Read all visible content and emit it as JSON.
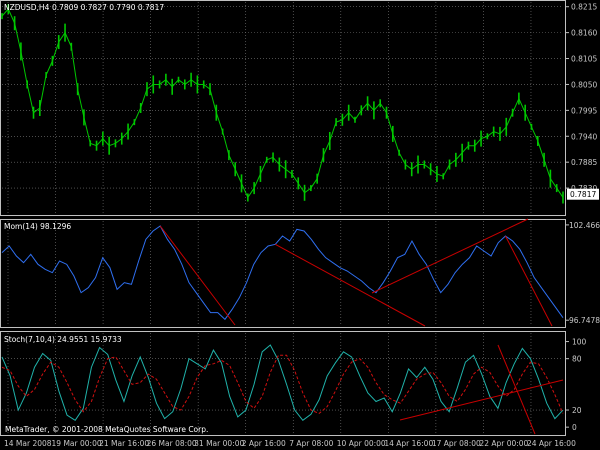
{
  "colors": {
    "background": "#000000",
    "frame": "#c0c0c0",
    "grid": "#7a7a7a",
    "price_line": "#00c800",
    "momentum": "#2f6ff0",
    "stoch_main": "#20b2aa",
    "stoch_signal": "#d01010",
    "trendline": "#c80000",
    "axis_text": "#c8c8c8",
    "price_box_bg": "#ffffff",
    "price_box_text": "#000000"
  },
  "price_panel": {
    "header_symbol": "NZDUSD,H4",
    "header_ohlc": "0.7809 0.7827 0.7790 0.7817",
    "current_price_label": "0.7817",
    "current_price": 0.7817
  },
  "momentum_panel": {
    "header": "Mom(14) 98.1296"
  },
  "stoch_panel": {
    "header": "Stoch(7,10,4) 24.9551 15.9733",
    "watermark": "MetaTrader, © 2001-2008 MetaQuotes Software Corp."
  },
  "chart_data": [
    {
      "type": "line",
      "name": "price",
      "y_ticks": [
        "0.8215",
        "0.8160",
        "0.8105",
        "0.8050",
        "0.7995",
        "0.7940",
        "0.7885",
        "0.7830"
      ],
      "ylim": [
        0.7775,
        0.8225
      ],
      "values": [
        0.8195,
        0.821,
        0.818,
        0.812,
        0.805,
        0.799,
        0.8,
        0.807,
        0.81,
        0.814,
        0.816,
        0.813,
        0.804,
        0.798,
        0.7925,
        0.792,
        0.7935,
        0.792,
        0.7925,
        0.7935,
        0.795,
        0.797,
        0.8,
        0.804,
        0.805,
        0.805,
        0.806,
        0.8045,
        0.806,
        0.805,
        0.806,
        0.805,
        0.805,
        0.804,
        0.799,
        0.795,
        0.79,
        0.787,
        0.784,
        0.781,
        0.783,
        0.786,
        0.789,
        0.7895,
        0.788,
        0.787,
        0.786,
        0.784,
        0.782,
        0.783,
        0.785,
        0.79,
        0.793,
        0.797,
        0.7975,
        0.799,
        0.7975,
        0.7995,
        0.801,
        0.7995,
        0.801,
        0.799,
        0.7945,
        0.7905,
        0.788,
        0.787,
        0.788,
        0.788,
        0.787,
        0.786,
        0.7855,
        0.788,
        0.789,
        0.7905,
        0.792,
        0.792,
        0.7935,
        0.794,
        0.795,
        0.7945,
        0.796,
        0.799,
        0.802,
        0.799,
        0.796,
        0.793,
        0.789,
        0.785,
        0.783,
        0.781
      ]
    },
    {
      "type": "line",
      "name": "momentum",
      "y_ticks": [
        "102.4661",
        "96.7478"
      ],
      "ylim": [
        96.4,
        102.7
      ],
      "values": [
        100.8,
        101.2,
        100.6,
        100.2,
        100.7,
        100.1,
        99.8,
        99.6,
        100.3,
        100.1,
        99.4,
        98.4,
        98.7,
        99.3,
        100.5,
        99.9,
        98.6,
        99.0,
        98.9,
        100.3,
        101.6,
        102.1,
        102.4,
        101.6,
        101.0,
        100.1,
        99.0,
        98.4,
        97.8,
        97.2,
        97.2,
        96.8,
        97.4,
        98.1,
        99.0,
        100.1,
        100.8,
        101.2,
        101.3,
        101.8,
        101.5,
        102.2,
        102.1,
        101.6,
        101.0,
        100.5,
        100.2,
        99.9,
        99.7,
        99.4,
        99.1,
        98.7,
        98.4,
        99.0,
        99.7,
        100.5,
        100.7,
        101.5,
        100.7,
        100.1,
        99.2,
        98.4,
        98.9,
        99.6,
        100.1,
        100.5,
        101.2,
        100.9,
        100.6,
        101.4,
        101.8,
        101.5,
        101.0,
        100.2,
        99.3,
        98.7,
        98.1,
        97.5,
        96.9
      ]
    },
    {
      "type": "line",
      "name": "stochastic",
      "y_ticks": [
        "100",
        "80",
        "20",
        "0"
      ],
      "ylim": [
        -8,
        110
      ],
      "main": [
        82,
        60,
        20,
        40,
        70,
        86,
        78,
        42,
        14,
        8,
        22,
        70,
        93,
        85,
        55,
        30,
        60,
        82,
        58,
        28,
        10,
        18,
        45,
        80,
        74,
        68,
        90,
        75,
        36,
        12,
        20,
        50,
        88,
        96,
        78,
        50,
        20,
        8,
        15,
        32,
        60,
        75,
        88,
        82,
        60,
        40,
        30,
        34,
        18,
        40,
        68,
        58,
        70,
        56,
        30,
        18,
        46,
        76,
        84,
        62,
        36,
        22,
        52,
        74,
        92,
        80,
        56,
        28,
        10,
        20
      ],
      "signal": [
        70,
        66,
        48,
        36,
        44,
        62,
        76,
        70,
        52,
        32,
        18,
        30,
        58,
        80,
        82,
        66,
        50,
        52,
        62,
        56,
        40,
        24,
        20,
        36,
        58,
        72,
        74,
        78,
        72,
        52,
        30,
        22,
        36,
        64,
        84,
        84,
        66,
        40,
        20,
        16,
        24,
        42,
        62,
        76,
        80,
        70,
        52,
        38,
        32,
        28,
        42,
        56,
        62,
        64,
        52,
        36,
        30,
        44,
        62,
        70,
        64,
        48,
        36,
        44,
        62,
        76,
        74,
        58,
        38,
        16
      ]
    }
  ],
  "x_axis": {
    "labels": [
      "14 Mar 2008",
      "19 Mar 00:00",
      "21 Mar 16:00",
      "26 Mar 08:00",
      "31 Mar 00:00",
      "2 Apr 16:00",
      "7 Apr 08:00",
      "10 Apr 00:00",
      "14 Apr 16:00",
      "17 Apr 08:00",
      "22 Apr 00:00",
      "24 Apr 16:00"
    ]
  }
}
